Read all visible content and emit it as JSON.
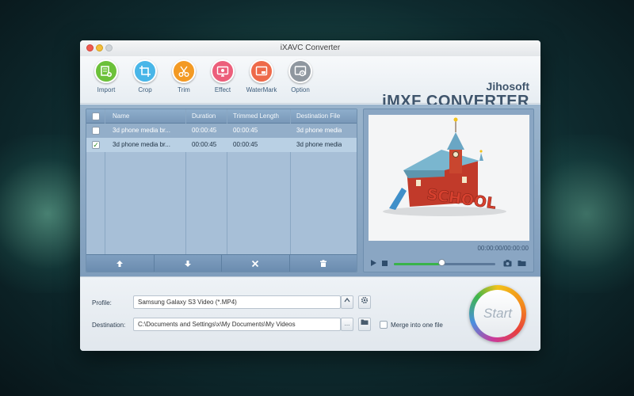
{
  "window": {
    "title": "iXAVC Converter"
  },
  "toolbar": {
    "tools": [
      {
        "label": "Import",
        "color": "#6cc13a",
        "icon": "import-icon"
      },
      {
        "label": "Crop",
        "color": "#49b6e8",
        "icon": "crop-icon"
      },
      {
        "label": "Trim",
        "color": "#f39a24",
        "icon": "trim-icon"
      },
      {
        "label": "Effect",
        "color": "#ec5f7b",
        "icon": "effect-icon"
      },
      {
        "label": "WaterMark",
        "color": "#ee6a4a",
        "icon": "watermark-icon"
      },
      {
        "label": "Option",
        "color": "#8f979f",
        "icon": "option-icon"
      }
    ],
    "brand_line1": "Jihosoft",
    "brand_line2": "iMXF CONVERTER"
  },
  "file_list": {
    "headers": {
      "name": "Name",
      "duration": "Duration",
      "trimmed": "Trimmed Length",
      "destination": "Destination File"
    },
    "rows": [
      {
        "checked": false,
        "name": "3d phone media br...",
        "duration": "00:00:45",
        "trimmed": "00:00:45",
        "destination": "3d phone media"
      },
      {
        "checked": true,
        "name": "3d phone media br...",
        "duration": "00:00:45",
        "trimmed": "00:00:45",
        "destination": "3d phone media"
      }
    ],
    "footer_icons": [
      "move-up-icon",
      "move-down-icon",
      "remove-icon",
      "delete-icon"
    ]
  },
  "preview": {
    "timecode": "00:00:00/00:00:00",
    "progress": 0.47
  },
  "output": {
    "profile_label": "Profile:",
    "profile_value": "Samsung Galaxy S3 Video (*.MP4)",
    "destination_label": "Destination:",
    "destination_value": "C:\\Documents and Settings\\x\\My Documents\\My Videos",
    "browse_label": "...",
    "merge_label": "Merge into one file",
    "merge_checked": false
  },
  "start_label": "Start"
}
